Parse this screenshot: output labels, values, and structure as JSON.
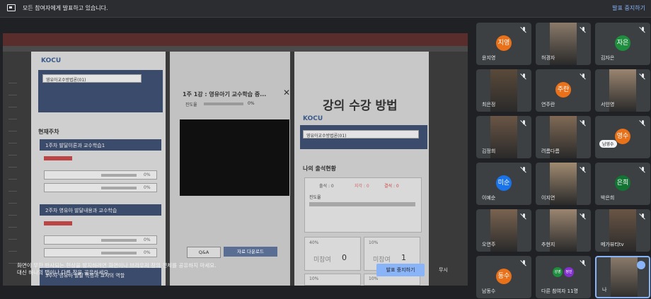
{
  "topbar": {
    "message": "모든 참여자에게 발표하고 있습니다.",
    "stop_label": "발표 중지하기"
  },
  "shared_screen": {
    "page1": {
      "logo": "KOCU",
      "course_select": "영유아교수방법론(01)",
      "section_title": "현재주차",
      "week1": "1주차 발달이론과 교수학습1",
      "week2": "2주차 영유아 발달내용과 교수학습",
      "week3": "3주차 영유아 발달 특성과 교사의 역할",
      "item_pct": "0%"
    },
    "page2": {
      "title": "1주 1강 : 영유아기 교수학습 중...",
      "progress_label": "진도율",
      "progress_pct": "0%",
      "qa_label": "Q&A",
      "download_label": "자료 다운로드"
    },
    "page3": {
      "title": "강의 수강 방법",
      "logo": "KOCU",
      "course_select": "영유아교수방법론(01)",
      "attendance_title": "나의 출석현황",
      "progress_label": "진도율",
      "absent_label": "미참여",
      "stats": [
        "출석 : 0",
        "지각 : 0",
        "결석 : 0"
      ],
      "cells": [
        {
          "pct": "40%",
          "count": "0"
        },
        {
          "pct": "10%",
          "count": "1"
        },
        {
          "pct": "10%",
          "count": "0"
        },
        {
          "pct": "10%",
          "count": "1"
        }
      ]
    },
    "notice_line1": "화면이 무한 반사되는 현상을 방지하려면 화면이나 브라우저 창의 전체를 공유하지 마세요.",
    "notice_line2": "대신 하나의 탭이나 다른 창을 공유하세요.",
    "stop_button": "발표 중지하기",
    "ignore_button": "무시"
  },
  "participants": [
    {
      "name": "윤지영",
      "avatar": "지영",
      "color": "#e8711a"
    },
    {
      "name": "허경자",
      "avatar": "",
      "color": ""
    },
    {
      "name": "김자은",
      "avatar": "자은",
      "color": "#1e8e3e"
    },
    {
      "name": "최은정",
      "avatar": "",
      "color": ""
    },
    {
      "name": "연주란",
      "avatar": "주란",
      "color": "#e8711a"
    },
    {
      "name": "서인영",
      "avatar": "",
      "color": ""
    },
    {
      "name": "김정희",
      "avatar": "",
      "color": ""
    },
    {
      "name": "려름다름",
      "avatar": "",
      "color": ""
    },
    {
      "name": "",
      "avatar": "영수",
      "color": "#e8711a",
      "tag": "남영수"
    },
    {
      "name": "이예순",
      "avatar": "미순",
      "color": "#1a73e8"
    },
    {
      "name": "이지연",
      "avatar": "",
      "color": ""
    },
    {
      "name": "박은희",
      "avatar": "은희",
      "color": "#137333"
    },
    {
      "name": "오연주",
      "avatar": "",
      "color": ""
    },
    {
      "name": "추현지",
      "avatar": "",
      "color": ""
    },
    {
      "name": "메가뷰티tv",
      "avatar": "",
      "color": ""
    },
    {
      "name": "남동수",
      "avatar": "동수",
      "color": "#e8711a"
    },
    {
      "name": "다른 참여자 11명",
      "avatar": "",
      "color": "",
      "mini": [
        "성영",
        "정민"
      ]
    },
    {
      "name": "나",
      "avatar": "",
      "color": ""
    }
  ]
}
